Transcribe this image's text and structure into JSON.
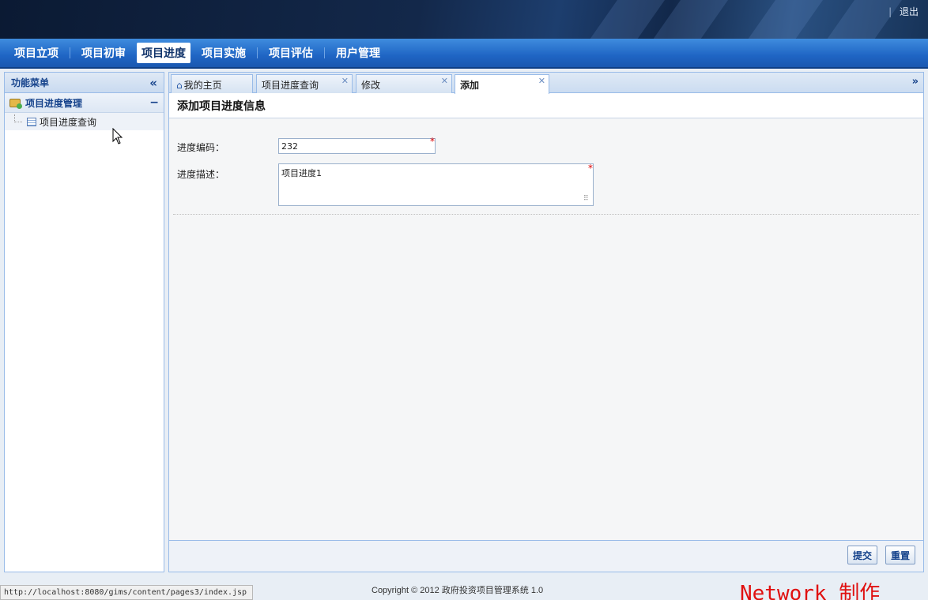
{
  "header": {
    "logout_label": "退出",
    "separator": "|"
  },
  "nav": {
    "items": [
      {
        "label": "项目立项"
      },
      {
        "label": "项目初审"
      },
      {
        "label": "项目进度"
      },
      {
        "label": "项目实施"
      },
      {
        "label": "项目评估"
      },
      {
        "label": "用户管理"
      }
    ],
    "active_index": 2
  },
  "sidebar": {
    "title": "功能菜单",
    "group": {
      "label": "项目进度管理"
    },
    "items": [
      {
        "label": "项目进度查询"
      }
    ]
  },
  "tabs": [
    {
      "label": "我的主页",
      "closable": false
    },
    {
      "label": "项目进度查询",
      "closable": true
    },
    {
      "label": "修改",
      "closable": true
    },
    {
      "label": "添加",
      "closable": true,
      "active": true
    }
  ],
  "form": {
    "title": "添加项目进度信息",
    "code_label": "进度编码：",
    "code_value": "232",
    "desc_label": "进度描述：",
    "desc_value": "项目进度1",
    "required_mark": "*"
  },
  "buttons": {
    "submit": "提交",
    "reset": "重置"
  },
  "statusbar": {
    "url": "http://localhost:8080/gims/content/pages3/index.jsp",
    "copyright": "Copyright © 2012 政府投资项目管理系统 1.0",
    "watermark": "Network 制作"
  },
  "colors": {
    "nav_blue": "#1f65c4",
    "header_dark": "#0b1a33",
    "panel_border": "#99bbe8",
    "required_red": "#dd0000"
  }
}
